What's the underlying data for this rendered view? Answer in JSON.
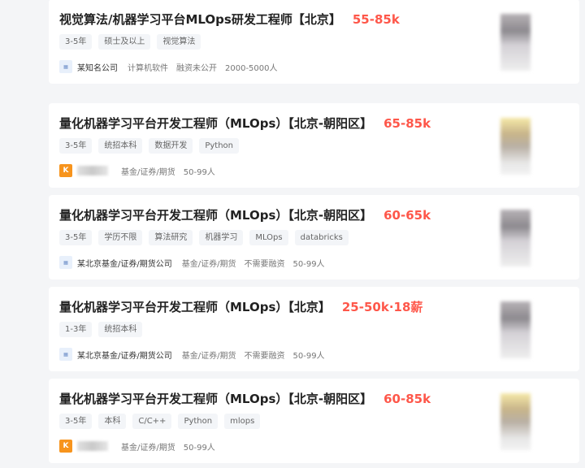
{
  "jobs": [
    {
      "title": "视觉算法/机器学习平台MLOps研发工程师【北京】",
      "salary": "55-85k",
      "tags": [
        "3-5年",
        "硕士及以上",
        "视觉算法"
      ],
      "company": "某知名公司",
      "meta": [
        "计算机软件",
        "融资未公开",
        "2000-5000人"
      ],
      "logo": "company-logo-icon"
    },
    {
      "title": "量化机器学习平台开发工程师（MLOps）【北京-朝阳区】",
      "salary": "65-85k",
      "tags": [
        "3-5年",
        "统招本科",
        "数据开发",
        "Python"
      ],
      "company": "",
      "meta": [
        "基金/证券/期货",
        "50-99人"
      ],
      "logo_text": "K"
    },
    {
      "title": "量化机器学习平台开发工程师（MLOps）【北京-朝阳区】",
      "salary": "60-65k",
      "tags": [
        "3-5年",
        "学历不限",
        "算法研究",
        "机器学习",
        "MLOps",
        "databricks"
      ],
      "company": "某北京基金/证券/期货公司",
      "meta": [
        "基金/证券/期货",
        "不需要融资",
        "50-99人"
      ]
    },
    {
      "title": "量化机器学习平台开发工程师（MLOps）【北京】",
      "salary": "25-50k·18薪",
      "tags": [
        "1-3年",
        "统招本科"
      ],
      "company": "某北京基金/证券/期货公司",
      "meta": [
        "基金/证券/期货",
        "不需要融资",
        "50-99人"
      ]
    },
    {
      "title": "量化机器学习平台开发工程师（MLOps）【北京-朝阳区】",
      "salary": "60-85k",
      "tags": [
        "3-5年",
        "本科",
        "C/C++",
        "Python",
        "mlops"
      ],
      "company": "",
      "meta": [
        "基金/证券/期货",
        "50-99人"
      ],
      "logo_text": "K"
    }
  ],
  "colors": {
    "salary": "#fe574a",
    "background": "#f4f5f7",
    "card": "#ffffff"
  }
}
